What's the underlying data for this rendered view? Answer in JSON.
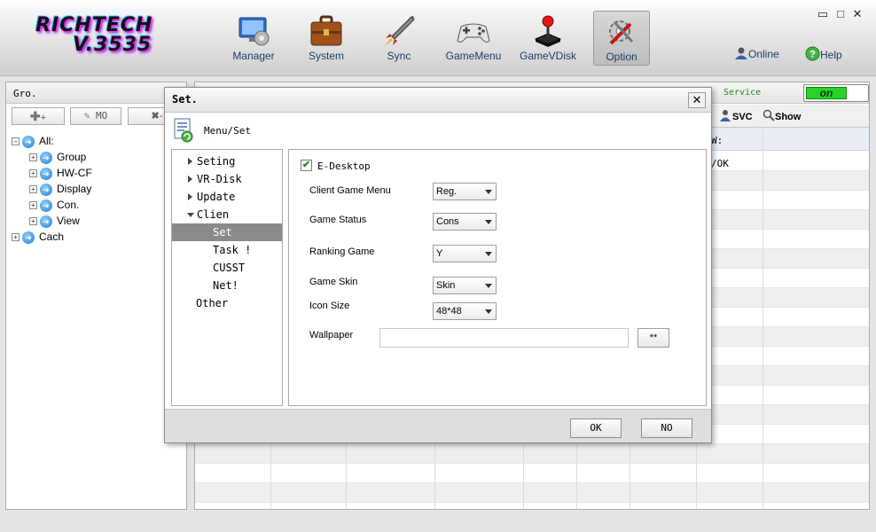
{
  "app": {
    "logo_line1": "RICHTECH",
    "logo_line2": "V.3535"
  },
  "toolbar": {
    "items": [
      {
        "label": "Manager",
        "icon": "manager-icon"
      },
      {
        "label": "System",
        "icon": "briefcase-icon"
      },
      {
        "label": "Sync",
        "icon": "rocket-icon"
      },
      {
        "label": "GameMenu",
        "icon": "gamepad-icon"
      },
      {
        "label": "GameVDisk",
        "icon": "joystick-icon"
      },
      {
        "label": "Option",
        "icon": "settings-tools-icon",
        "selected": true
      }
    ],
    "online": "Online",
    "help": "Help"
  },
  "window_controls": {
    "minimize": "▭",
    "maximize": "□",
    "close": "✕"
  },
  "left_panel": {
    "header": "Gro.",
    "buttons": [
      "+",
      "MO",
      "-"
    ],
    "tree": [
      {
        "label": "All:",
        "level": 0,
        "expander": "−"
      },
      {
        "label": "Group",
        "level": 1,
        "expander": "+"
      },
      {
        "label": "HW-CF",
        "level": 1,
        "expander": "+"
      },
      {
        "label": "Display",
        "level": 1,
        "expander": "+"
      },
      {
        "label": "Con.",
        "level": 1,
        "expander": "+"
      },
      {
        "label": "View",
        "level": 1,
        "expander": "+"
      },
      {
        "label": "Cach",
        "level": 0,
        "expander": "+"
      }
    ]
  },
  "right_panel": {
    "service_label": "Service",
    "toggle_label": "on",
    "svc_button": "SVC",
    "show_button": "Show",
    "column_header_fragment": "W:",
    "cell_fragment": "/OK"
  },
  "dialog": {
    "title": "Set.",
    "close": "✕",
    "section_title": "Menu/Set",
    "nav": [
      {
        "label": "Seting",
        "type": "collapsed"
      },
      {
        "label": "VR-Disk",
        "type": "collapsed"
      },
      {
        "label": "Update",
        "type": "collapsed"
      },
      {
        "label": "Clien",
        "type": "expanded"
      },
      {
        "label": "Set",
        "type": "child",
        "selected": true
      },
      {
        "label": "Task !",
        "type": "child"
      },
      {
        "label": "CUSST",
        "type": "child"
      },
      {
        "label": "Net!",
        "type": "child"
      },
      {
        "label": "Other",
        "type": "leaf"
      }
    ],
    "settings": {
      "edesktop_label": "E-Desktop",
      "edesktop_checked": true,
      "fields": [
        {
          "label": "Client Game Menu",
          "value": "Reg."
        },
        {
          "label": "Game Status",
          "value": "Cons"
        },
        {
          "label": "Ranking Game",
          "value": "Y"
        },
        {
          "label": "Game Skin",
          "value": "Skin"
        },
        {
          "label": "Icon Size",
          "value": "48*48"
        }
      ],
      "wallpaper_label": "Wallpaper",
      "wallpaper_value": "",
      "browse_button": "**"
    },
    "ok": "OK",
    "cancel": "NO"
  }
}
